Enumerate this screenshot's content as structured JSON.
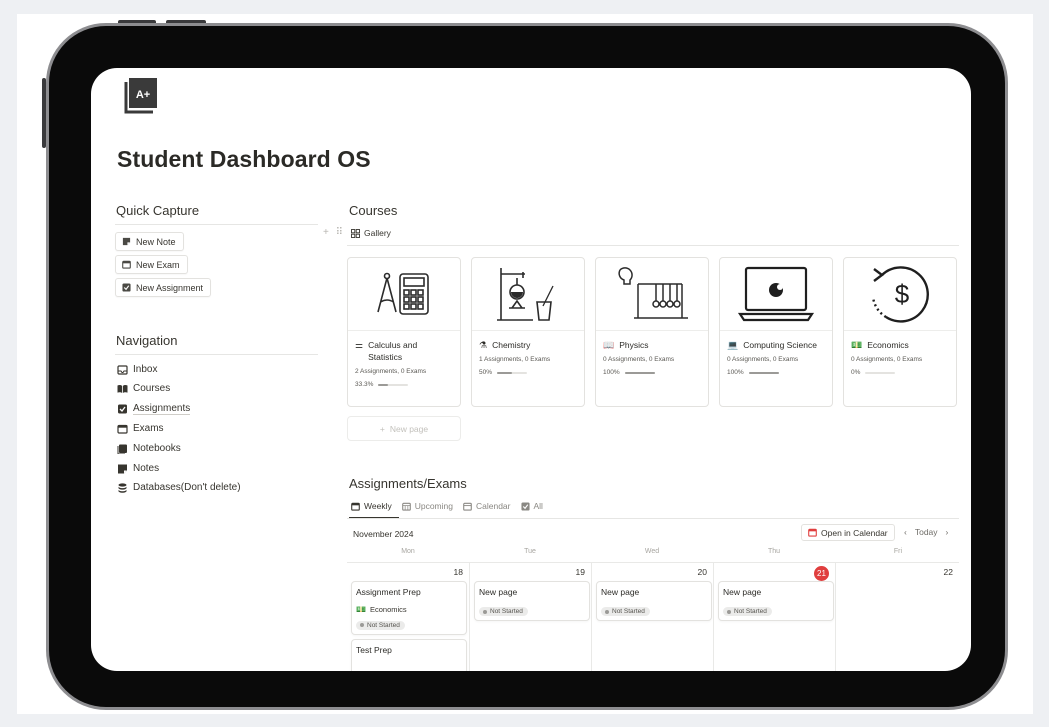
{
  "page": {
    "icon_text": "A+",
    "title": "Student Dashboard OS"
  },
  "quick_capture": {
    "heading": "Quick Capture",
    "buttons": [
      "New Note",
      "New Exam",
      "New Assignment"
    ]
  },
  "navigation": {
    "heading": "Navigation",
    "items": [
      "Inbox",
      "Courses",
      "Assignments",
      "Exams",
      "Notebooks",
      "Notes",
      "Databases(Don't delete)"
    ]
  },
  "courses": {
    "heading": "Courses",
    "view_label": "Gallery",
    "cards": [
      {
        "title": "Calculus and Statistics",
        "meta": "2 Assignments, 0 Exams",
        "progress_label": "33.3%",
        "progress": 0.333,
        "thumb": "calculator-compass-icon"
      },
      {
        "title": "Chemistry",
        "meta": "1 Assignments, 0 Exams",
        "progress_label": "50%",
        "progress": 0.5,
        "thumb": "lab-flask-icon"
      },
      {
        "title": "Physics",
        "meta": "0 Assignments, 0 Exams",
        "progress_label": "100%",
        "progress": 1.0,
        "thumb": "newtons-cradle-icon"
      },
      {
        "title": "Computing Science",
        "meta": "0 Assignments, 0 Exams",
        "progress_label": "100%",
        "progress": 1.0,
        "thumb": "laptop-icon"
      },
      {
        "title": "Economics",
        "meta": "0 Assignments, 0 Exams",
        "progress_label": "0%",
        "progress": 0.0,
        "thumb": "dollar-refresh-icon"
      }
    ],
    "new_page_label": "New page"
  },
  "assignments": {
    "heading": "Assignments/Exams",
    "tabs": [
      "Weekly",
      "Upcoming",
      "Calendar",
      "All"
    ],
    "month": "November 2024",
    "open_calendar_label": "Open in Calendar",
    "today_label": "Today",
    "day_heads": [
      "Mon",
      "Tue",
      "Wed",
      "Thu",
      "Fri"
    ],
    "day_numbers": [
      "18",
      "19",
      "20",
      "21",
      "22"
    ],
    "events": {
      "mon_1_title": "Assignment Prep",
      "mon_1_course": "Economics",
      "mon_2_title": "Test Prep",
      "tue_title": "New page",
      "wed_title": "New page",
      "thu_title": "New page",
      "status": "Not Started"
    }
  },
  "colors": {
    "accent_today": "#e03e3e",
    "device_frame": "#0a0a0a"
  }
}
